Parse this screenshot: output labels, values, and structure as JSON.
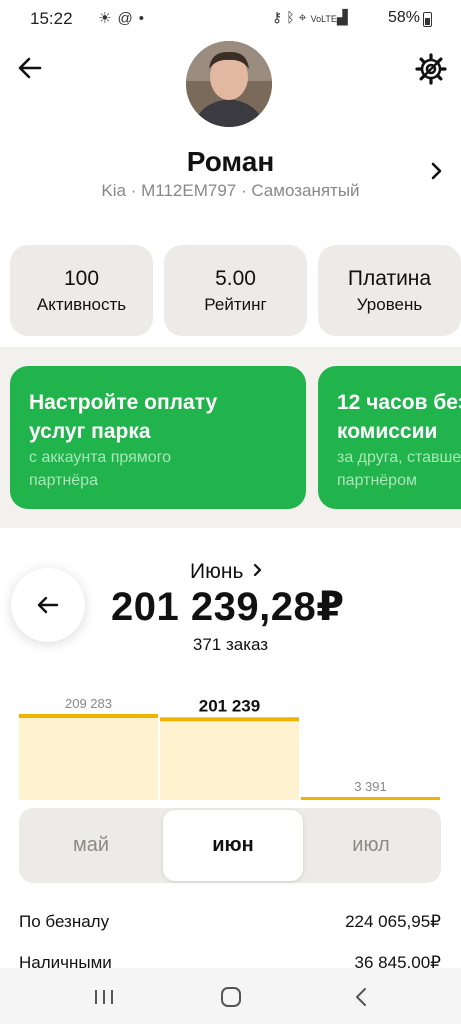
{
  "status_bar": {
    "time": "15:22",
    "left_icons": [
      "sun-icon",
      "at-icon",
      "dot-icon"
    ],
    "right_icons": [
      "key-icon",
      "bluetooth-icon",
      "location-icon",
      "volte-icon",
      "signal-icon"
    ],
    "battery_percent": "58%"
  },
  "header": {
    "back_icon": "arrow-left-icon",
    "settings_icon": "gear-icon"
  },
  "profile": {
    "name": "Роман",
    "subtitle": "Kia · М112ЕМ797 · Самозанятый"
  },
  "stats": [
    {
      "value": "100",
      "label": "Активность"
    },
    {
      "value": "5.00",
      "label": "Рейтинг"
    },
    {
      "value": "Платина",
      "label": "Уровень"
    }
  ],
  "promos": [
    {
      "title_1": "Настройте оплату",
      "title_2": "услуг парка",
      "sub_1": "с аккаунта прямого",
      "sub_2": "партнёра"
    },
    {
      "title_1": "12 часов без",
      "title_2": "комиссии",
      "sub_1": "за друга, ставшего",
      "sub_2": "партнёром"
    }
  ],
  "summary": {
    "month": "Июнь",
    "amount": "201 239,28₽",
    "orders": "371 заказ"
  },
  "chart_data": {
    "type": "bar",
    "categories": [
      "май",
      "июн",
      "июл"
    ],
    "values": [
      209283,
      201239,
      3391
    ],
    "labels": [
      "209 283",
      "201 239",
      "3 391"
    ],
    "selected_index": 1
  },
  "tabs": [
    "май",
    "июн",
    "июл"
  ],
  "payments": [
    {
      "label": "По безналу",
      "value": "224 065,95₽"
    },
    {
      "label": "Наличными",
      "value": "36 845,00₽"
    }
  ],
  "colors": {
    "bar_fill": "#fff3cf",
    "bar_top": "#f0b400",
    "promo_green": "#21b34c",
    "card_bg": "#edebe7"
  }
}
